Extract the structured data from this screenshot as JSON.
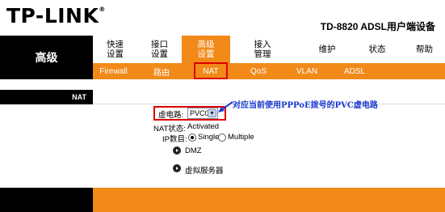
{
  "brand": {
    "logo": "TP-LINK",
    "mark": "®",
    "model": "TD-8820  ADSL用户端设备"
  },
  "section_title": "高级",
  "nav": [
    {
      "line1": "快速",
      "line2": "设置"
    },
    {
      "line1": "接口",
      "line2": "设置"
    },
    {
      "line1": "高级",
      "line2": "设置"
    },
    {
      "line1": "接入",
      "line2": "管理"
    },
    {
      "line1": "维护",
      "line2": ""
    },
    {
      "line1": "状态",
      "line2": ""
    },
    {
      "line1": "帮助",
      "line2": ""
    }
  ],
  "subnav": [
    "Firewall",
    "路由",
    "NAT",
    "QoS",
    "VLAN",
    "ADSL"
  ],
  "page": {
    "left_label": "NAT"
  },
  "form": {
    "vc_label": "虚电路:",
    "vc_value": "PVC0",
    "status_label": "NAT状态:",
    "status_value": "Activated",
    "ip_label": "IP数目:",
    "ip_single": "Single",
    "ip_multiple": "Multiple",
    "ip_selected": "Single"
  },
  "links": {
    "dmz": "DMZ",
    "virtual_server": "虚拟服务器"
  },
  "annotation": "对应当前使用PPPoE拨号的PVC虚电路",
  "colors": {
    "accent": "#f28a1a",
    "highlight": "#dd0000",
    "annotation": "#1a3ad0"
  }
}
